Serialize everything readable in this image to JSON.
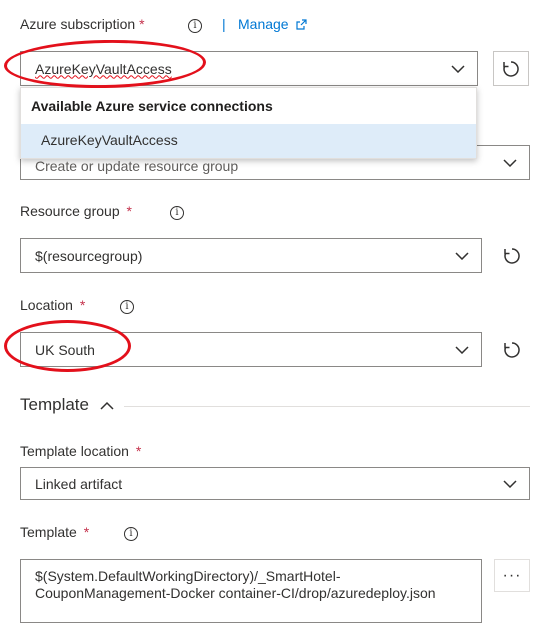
{
  "subscription": {
    "label": "Azure subscription",
    "required_mark": "*",
    "manage_separator": "|",
    "manage_label": "Manage",
    "value": "AzureKeyVaultAccess"
  },
  "dropdown": {
    "header": "Available Azure service connections",
    "items": [
      "AzureKeyVaultAccess"
    ]
  },
  "action": {
    "value": "Create or update resource group"
  },
  "resource_group": {
    "label": "Resource group",
    "required_mark": "*",
    "value": "$(resourcegroup)"
  },
  "location": {
    "label": "Location",
    "required_mark": "*",
    "value": "UK South"
  },
  "template_section": {
    "title": "Template"
  },
  "template_location": {
    "label": "Template location",
    "required_mark": "*",
    "value": "Linked artifact"
  },
  "template": {
    "label": "Template",
    "required_mark": "*",
    "value": "$(System.DefaultWorkingDirectory)/_SmartHotel-CouponManagement-Docker container-CI/drop/azuredeploy.json",
    "more_label": "···"
  },
  "colors": {
    "accent": "#0078d4",
    "required": "#c4314b",
    "highlight": "#deecf9",
    "annotation": "#e3101b"
  }
}
